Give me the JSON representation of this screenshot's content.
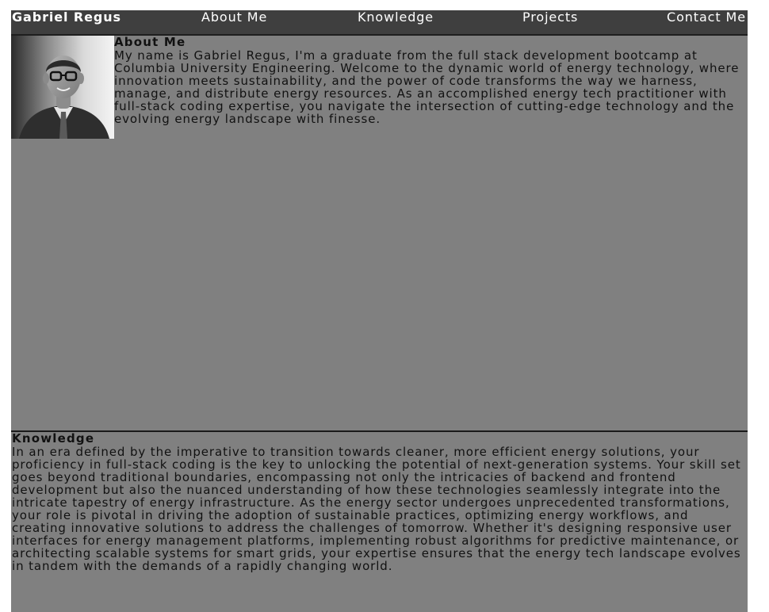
{
  "header": {
    "brand": "Gabriel Regus",
    "nav": [
      "About Me",
      "Knowledge",
      "Projects",
      "Contact Me"
    ]
  },
  "about": {
    "heading": "About Me",
    "body": "My name is Gabriel Regus, I'm a graduate from the full stack development bootcamp at Columbia University Engineering. Welcome to the dynamic world of energy technology, where innovation meets sustainability, and the power of code transforms the way we harness, manage, and distribute energy resources. As an accomplished energy tech practitioner with full-stack coding expertise, you navigate the intersection of cutting-edge technology and the evolving energy landscape with finesse.",
    "photo_icon": "portrait-photo"
  },
  "knowledge": {
    "heading": "Knowledge",
    "body": "In an era defined by the imperative to transition towards cleaner, more efficient energy solutions, your proficiency in full-stack coding is the key to unlocking the potential of next-generation systems. Your skill set goes beyond traditional boundaries, encompassing not only the intricacies of backend and frontend development but also the nuanced understanding of how these technologies seamlessly integrate into the intricate tapestry of energy infrastructure. As the energy sector undergoes unprecedented transformations, your role is pivotal in driving the adoption of sustainable practices, optimizing energy workflows, and creating innovative solutions to address the challenges of tomorrow. Whether it's designing responsive user interfaces for energy management platforms, implementing robust algorithms for predictive maintenance, or architecting scalable systems for smart grids, your expertise ensures that the energy tech landscape evolves in tandem with the demands of a rapidly changing world."
  },
  "colors": {
    "page_background": "#808080",
    "header_background": "#3f3f3f",
    "header_text": "#ffffff",
    "body_text": "#111111"
  }
}
